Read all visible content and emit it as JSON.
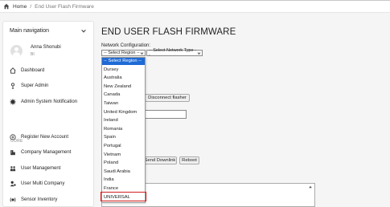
{
  "breadcrumb": {
    "home": "Home",
    "separator": "/",
    "current": "End User Flash Firmware"
  },
  "sidebar": {
    "title": "Main navigation",
    "user": {
      "name": "Anna Shonubi",
      "role": "BI"
    },
    "items": [
      {
        "label": "Dashboard",
        "icon": "home-icon"
      },
      {
        "label": "Super Admin",
        "icon": "person-icon"
      },
      {
        "label": "Admin System Notification",
        "icon": "gear-icon"
      }
    ],
    "section_label": "CORE",
    "core_items": [
      {
        "label": "Register New Account",
        "icon": "plus-circle-icon"
      },
      {
        "label": "Company Management",
        "icon": "building-icon"
      },
      {
        "label": "User Management",
        "icon": "users-icon"
      },
      {
        "label": "User Multi Company",
        "icon": "user-multi-icon"
      },
      {
        "label": "Sensor Inventory",
        "icon": "sensor-icon"
      }
    ]
  },
  "main": {
    "title": "END USER FLASH FIRMWARE",
    "network_label": "Network Configuration:",
    "region_select": "-- Select Region --",
    "network_select": "-- Select Network Type --",
    "region_options": [
      "-- Select Region --",
      "Dursey",
      "Australia",
      "New Zealand",
      "Canada",
      "Taiwan",
      "United Kingdom",
      "Ireland",
      "Romania",
      "Spain",
      "Portugal",
      "Vietnam",
      "Poland",
      "Saudi Arabia",
      "India",
      "France",
      "UNIVERSAL"
    ],
    "buttons": {
      "disconnect": "Disconnect flasher",
      "send_downlink": "Send Downlink",
      "reboot": "Reboot"
    }
  },
  "colors": {
    "accent": "#1e6ad6",
    "highlight": "#d01c1c"
  }
}
